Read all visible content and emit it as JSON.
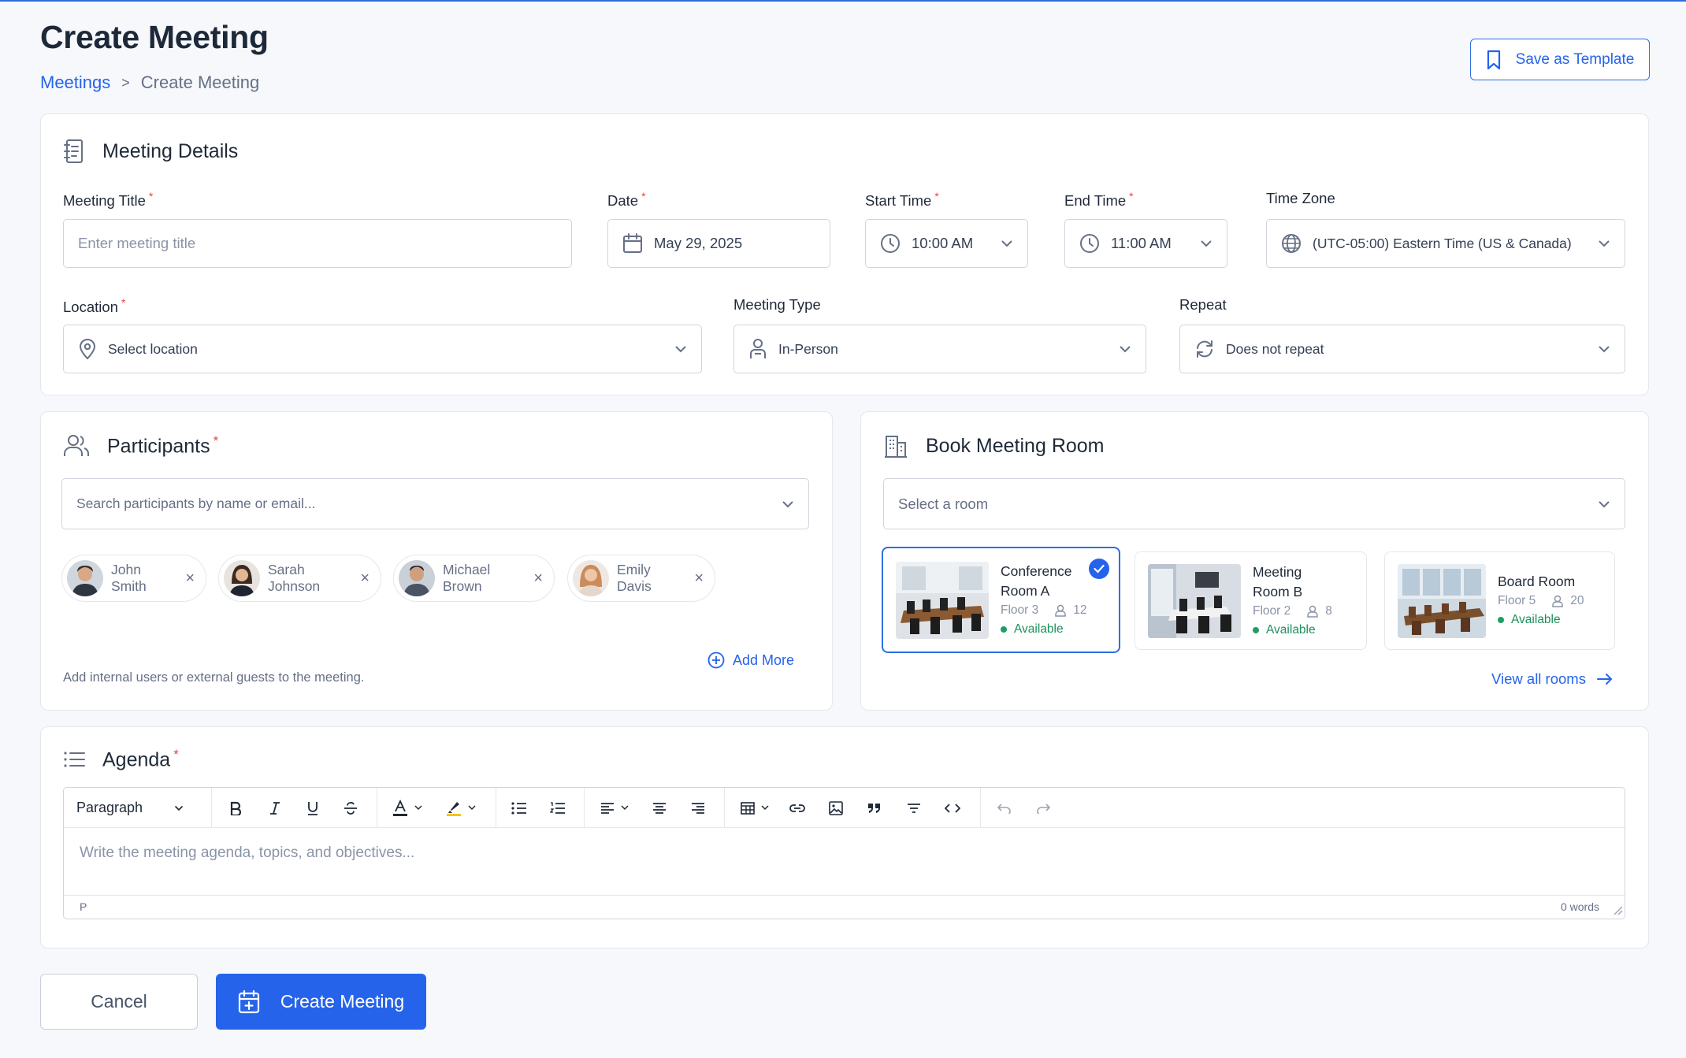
{
  "header": {
    "title": "Create Meeting",
    "breadcrumb_parent": "Meetings",
    "breadcrumb_separator": ">",
    "breadcrumb_current": "Create Meeting",
    "save_template_label": "Save as Template"
  },
  "details": {
    "heading": "Meeting Details",
    "required_mark": "*",
    "title_label": "Meeting Title",
    "title_placeholder": "Enter meeting title",
    "date_label": "Date",
    "date_value": "May 29, 2025",
    "start_label": "Start Time",
    "start_value": "10:00 AM",
    "end_label": "End Time",
    "end_value": "11:00 AM",
    "tz_label": "Time Zone",
    "tz_value": "(UTC-05:00) Eastern Time (US & Canada)",
    "location_label": "Location",
    "location_placeholder": "Select location",
    "type_label": "Meeting Type",
    "type_value": "In-Person",
    "repeat_label": "Repeat",
    "repeat_value": "Does not repeat"
  },
  "participants": {
    "heading": "Participants",
    "search_placeholder": "Search participants by name or email...",
    "chips": [
      {
        "name": "John Smith",
        "remove": "×"
      },
      {
        "name": "Sarah Johnson",
        "remove": "×"
      },
      {
        "name": "Michael Brown",
        "remove": "×"
      },
      {
        "name": "Emily Davis",
        "remove": "×"
      }
    ],
    "add_more": "Add More",
    "helper": "Add internal users or external guests to the meeting."
  },
  "room": {
    "heading": "Book Meeting Room",
    "select_placeholder": "Select a room",
    "rooms": [
      {
        "name_line1": "Conference",
        "name_line2": "Room A",
        "floor": "Floor 3",
        "capacity": "12",
        "status": "Available",
        "selected": true
      },
      {
        "name_line1": "Meeting",
        "name_line2": "Room B",
        "floor": "Floor 2",
        "capacity": "8",
        "status": "Available",
        "selected": false
      },
      {
        "name_line1": "Board Room",
        "name_line2": "",
        "floor": "Floor 5",
        "capacity": "20",
        "status": "Available",
        "selected": false
      }
    ],
    "view_all": "View all rooms"
  },
  "agenda": {
    "heading": "Agenda",
    "block_format": "Paragraph",
    "placeholder": "Write the meeting agenda, topics, and objectives...",
    "path": "P",
    "word_count": "0 words"
  },
  "actions": {
    "cancel": "Cancel",
    "create": "Create Meeting"
  },
  "colors": {
    "accent": "#2563eb",
    "required": "#e5484d",
    "available": "#1f9d63"
  }
}
